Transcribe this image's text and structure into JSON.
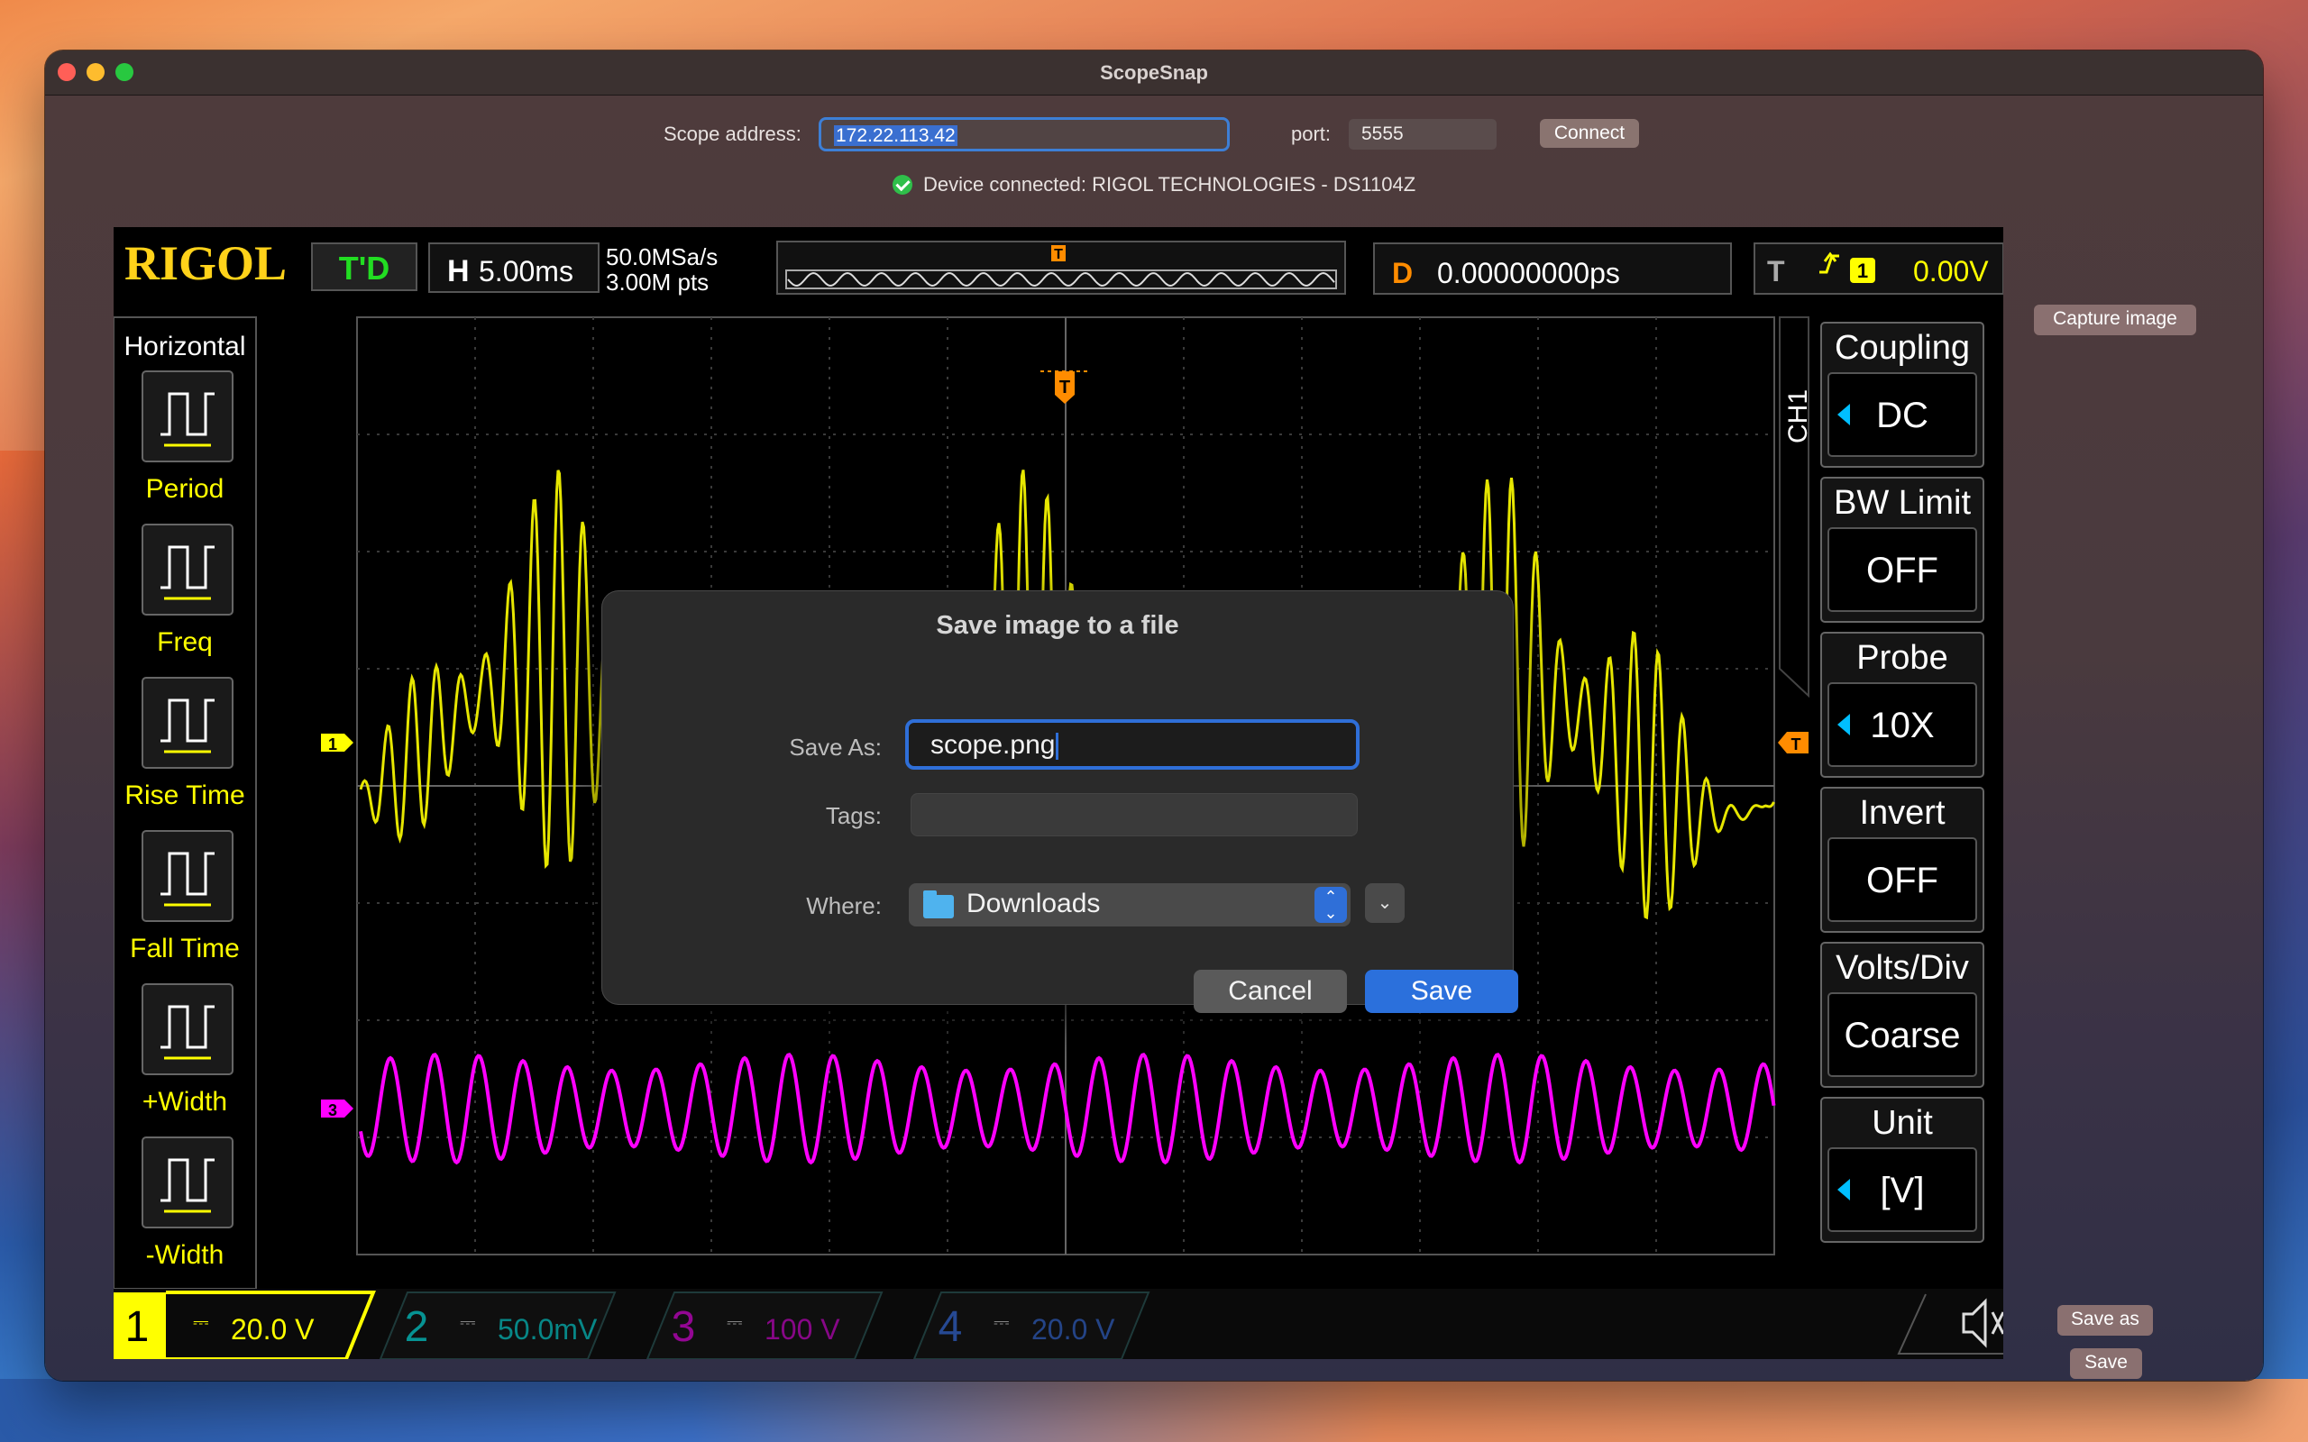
{
  "window": {
    "title": "ScopeSnap"
  },
  "connection": {
    "address_label": "Scope address:",
    "address_value": "172.22.113.42",
    "port_label": "port:",
    "port_value": "5555",
    "connect_label": "Connect",
    "status_text": "Device connected: RIGOL TECHNOLOGIES - DS1104Z"
  },
  "actions": {
    "capture_label": "Capture image",
    "save_as_label": "Save as",
    "save_label": "Save"
  },
  "scope": {
    "brand": "RIGOL",
    "run_state": "T'D",
    "timebase_letter": "H",
    "timebase": "5.00ms",
    "sample_rate": "50.0MSa/s",
    "memory_depth": "3.00M pts",
    "delay_letter": "D",
    "delay": "0.00000000ps",
    "trigger_letter": "T",
    "trigger_channel": "1",
    "trigger_level": "0.00V",
    "left_menu_title": "Horizontal",
    "left_menu": [
      "Period",
      "Freq",
      "Rise Time",
      "Fall Time",
      "+Width",
      "-Width"
    ],
    "right_menu_channel": "CH1",
    "right_menu": [
      {
        "label": "Coupling",
        "value": "DC"
      },
      {
        "label": "BW Limit",
        "value": "OFF"
      },
      {
        "label": "Probe",
        "value": "10X"
      },
      {
        "label": "Invert",
        "value": "OFF"
      },
      {
        "label": "Volts/Div",
        "value": "Coarse"
      },
      {
        "label": "Unit",
        "value": "[V]"
      }
    ],
    "channels": [
      {
        "num": "1",
        "scale": "20.0 V",
        "color": "#ffff00"
      },
      {
        "num": "2",
        "scale": "50.0mV",
        "color": "#00ffff"
      },
      {
        "num": "3",
        "scale": "100 V",
        "color": "#ff00ff"
      },
      {
        "num": "4",
        "scale": "20.0 V",
        "color": "#3a7aff"
      }
    ],
    "ch1_marker": "1",
    "ch3_marker": "3",
    "trigger_marker": "T"
  },
  "dialog": {
    "title": "Save image to a file",
    "save_as_label": "Save As:",
    "filename": "scope.png",
    "tags_label": "Tags:",
    "where_label": "Where:",
    "where_value": "Downloads",
    "cancel_label": "Cancel",
    "save_label": "Save"
  },
  "colors": {
    "ch1": "#ffff00",
    "ch3": "#ff00ff",
    "accent": "#2b70dc",
    "trigger": "#ff8c00"
  }
}
